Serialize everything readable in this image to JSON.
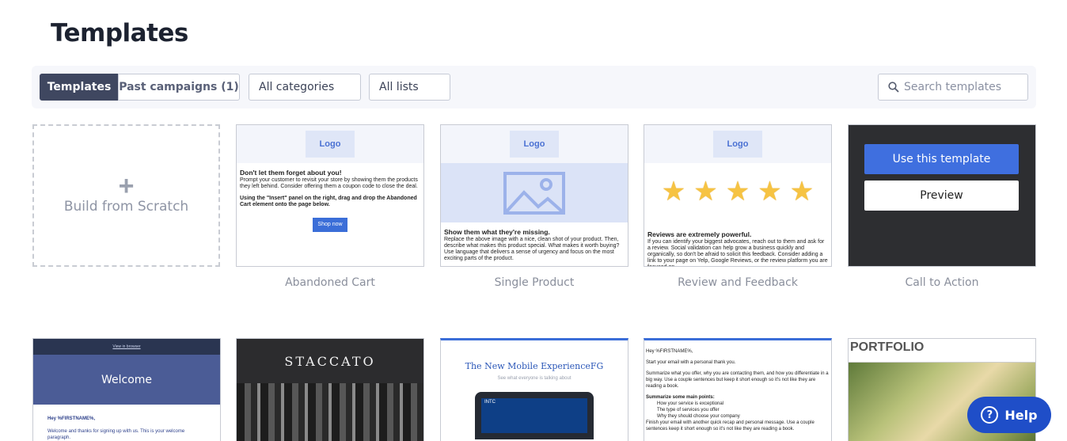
{
  "page": {
    "title": "Templates"
  },
  "toolbar": {
    "tab_templates": "Templates",
    "tab_past": "Past campaigns (1)",
    "category_select": "All categories",
    "lists_select": "All lists",
    "search_placeholder": "Search templates"
  },
  "scratch": {
    "label": "Build from Scratch"
  },
  "templates_row1": [
    {
      "name": "Abandoned Cart",
      "logo": "Logo",
      "heading": "Don't let them forget about you!",
      "body": "Prompt your customer to revisit your store by showing them the products they left behind. Consider offering them a coupon code to close the deal.",
      "body2": "Using the \"Insert\" panel on the right, drag and drop the Abandoned Cart element onto the page below.",
      "button": "Shop now"
    },
    {
      "name": "Single Product",
      "logo": "Logo",
      "heading": "Show them what they're missing.",
      "body": "Replace the above image with a nice, clean shot of your product. Then, describe what makes this product special. What makes it worth buying? Use language that delivers a sense of urgency and focus on the most exciting parts of the product."
    },
    {
      "name": "Review and Feedback",
      "logo": "Logo",
      "heading": "Reviews are extremely powerful.",
      "body": "If you can identify your biggest advocates, reach out to them and ask for a review. Social validation can help grow a business quickly and organically, so don't be afraid to solicit this feedback. Consider adding a link to your page on Yelp, Google Reviews, or the review platform you are focused on.",
      "stars": 5
    },
    {
      "name": "Call to Action",
      "use_button": "Use this template",
      "preview_button": "Preview"
    }
  ],
  "templates_row2": {
    "welcome": {
      "top_link": "View in browser",
      "hero": "Welcome",
      "greeting": "Hey %FIRSTNAME%,",
      "body": "Welcome and thanks for signing up with us. This is your welcome paragraph."
    },
    "staccato": {
      "brand": "STACCATO"
    },
    "mobile": {
      "title": "The New Mobile ExperienceFG",
      "subtitle": "See what everyone is talking about",
      "ticker": "INTC"
    },
    "letter": {
      "greeting": "Hey %FIRSTNAME%,",
      "line1": "Start your email with a personal thank you.",
      "line2": "Summarize what you offer, why you are contacting them, and how you differentiate in a big way. Use a couple sentences but keep it short enough so it's not like they are reading a book.",
      "points_title": "Summarize some main points:",
      "points": [
        "How your service is exceptional",
        "The type of services you offer",
        "Why they should choose your company"
      ],
      "line3": "Finish your email with another quick recap and personal message. Use a couple sentences keep it short enough so it's not like they are reading a book."
    },
    "portfolio": {
      "title": "PORTFOLIO"
    }
  },
  "help": {
    "label": "Help"
  },
  "colors": {
    "accent": "#3f6fdf",
    "active_tab": "#3f4760",
    "help": "#1f4ec8"
  }
}
